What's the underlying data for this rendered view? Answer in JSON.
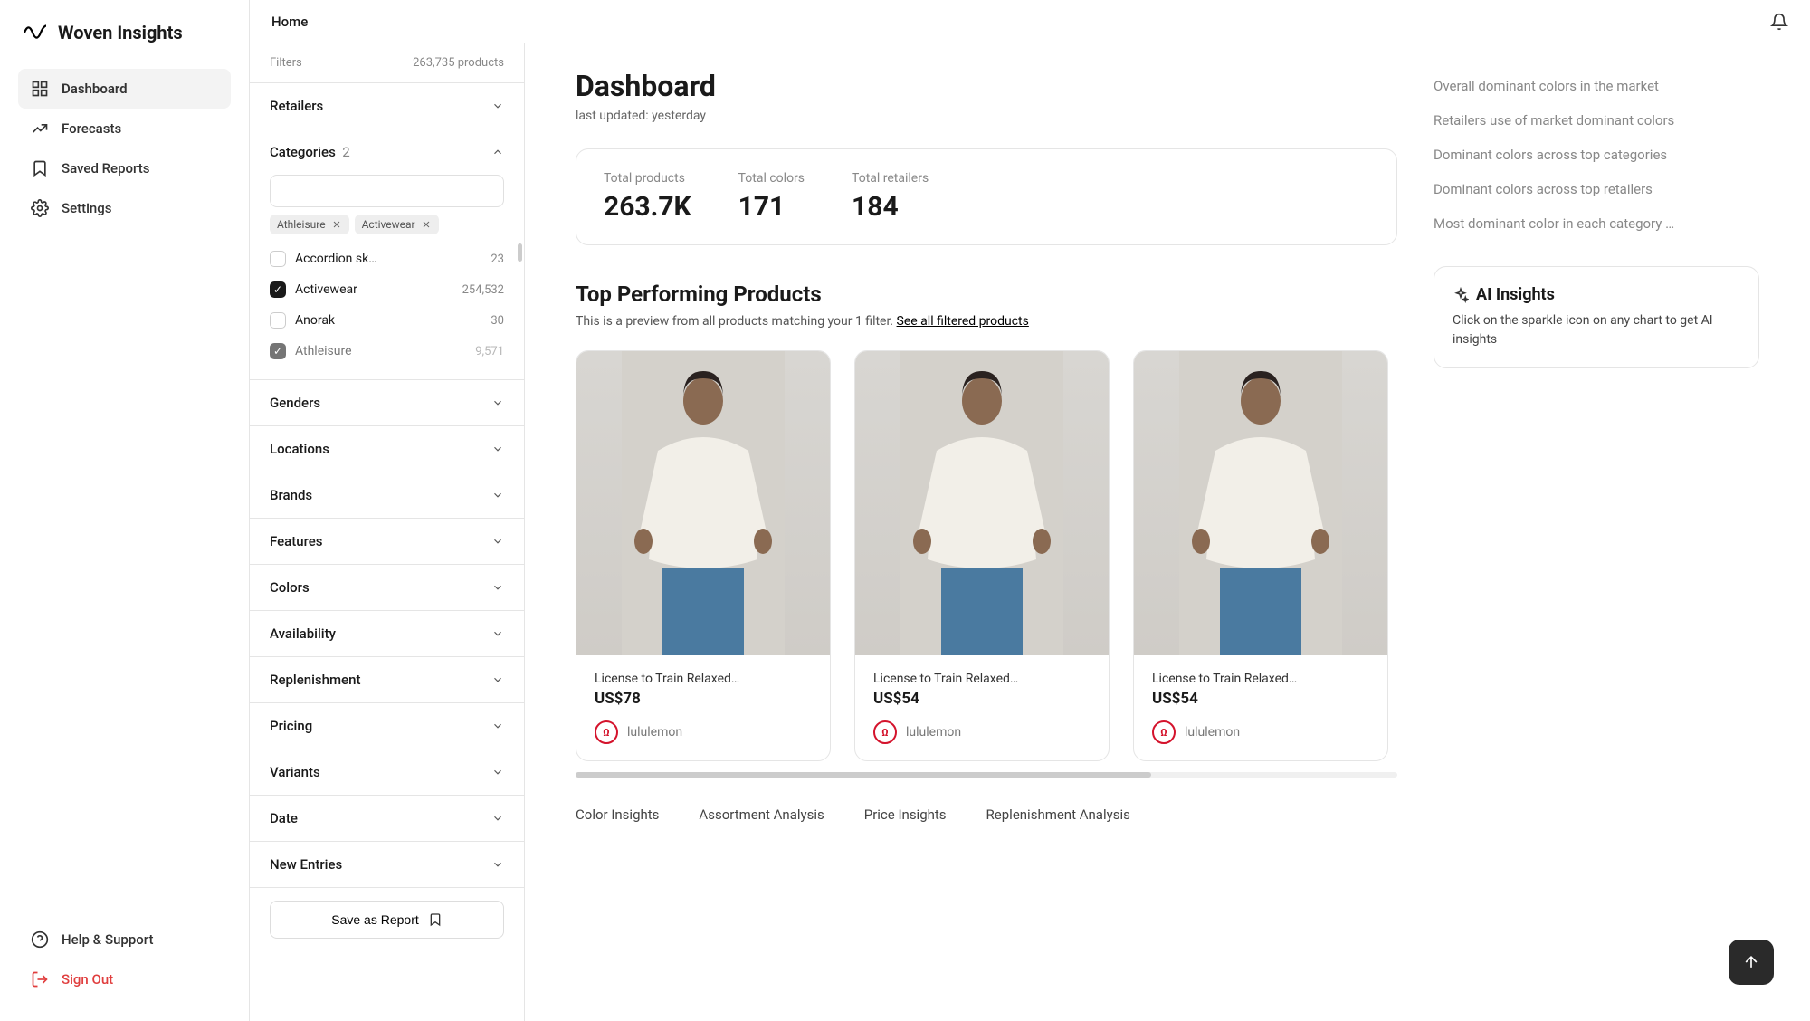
{
  "app_name": "Woven Insights",
  "breadcrumb": "Home",
  "nav": {
    "items": [
      {
        "label": "Dashboard",
        "icon": "dashboard-icon",
        "active": true
      },
      {
        "label": "Forecasts",
        "icon": "forecasts-icon"
      },
      {
        "label": "Saved Reports",
        "icon": "bookmark-icon"
      },
      {
        "label": "Settings",
        "icon": "gear-icon"
      }
    ],
    "bottom": [
      {
        "label": "Help & Support",
        "icon": "help-icon"
      },
      {
        "label": "Sign Out",
        "icon": "signout-icon",
        "danger": true
      }
    ]
  },
  "filters": {
    "header_label": "Filters",
    "product_count": "263,735 products",
    "sections": [
      {
        "label": "Retailers"
      },
      {
        "label": "Genders"
      },
      {
        "label": "Locations"
      },
      {
        "label": "Brands"
      },
      {
        "label": "Features"
      },
      {
        "label": "Colors"
      },
      {
        "label": "Availability"
      },
      {
        "label": "Replenishment"
      },
      {
        "label": "Pricing"
      },
      {
        "label": "Variants"
      },
      {
        "label": "Date"
      },
      {
        "label": "New Entries"
      }
    ],
    "categories": {
      "label": "Categories",
      "selected_count": "2",
      "chips": [
        "Athleisure",
        "Activewear"
      ],
      "items": [
        {
          "label": "Accordion sk…",
          "count": "23",
          "checked": false
        },
        {
          "label": "Activewear",
          "count": "254,532",
          "checked": true
        },
        {
          "label": "Anorak",
          "count": "30",
          "checked": false
        },
        {
          "label": "Athleisure",
          "count": "9,571",
          "checked": true
        }
      ]
    },
    "save_button": "Save as Report"
  },
  "dashboard": {
    "title": "Dashboard",
    "subtitle": "last updated: yesterday",
    "stats": [
      {
        "label": "Total products",
        "value": "263.7K"
      },
      {
        "label": "Total colors",
        "value": "171"
      },
      {
        "label": "Total retailers",
        "value": "184"
      }
    ],
    "top_products_title": "Top Performing Products",
    "top_products_lead": "This is a preview from all products matching your 1 filter. ",
    "top_products_link": "See all filtered products",
    "products": [
      {
        "name": "License to Train Relaxed…",
        "price": "US$78",
        "brand": "lululemon"
      },
      {
        "name": "License to Train Relaxed…",
        "price": "US$54",
        "brand": "lululemon"
      },
      {
        "name": "License to Train Relaxed…",
        "price": "US$54",
        "brand": "lululemon"
      }
    ],
    "tabs": [
      "Color Insights",
      "Assortment Analysis",
      "Price Insights",
      "Replenishment Analysis"
    ]
  },
  "insights": {
    "links": [
      "Overall dominant colors in the market",
      "Retailers use of market dominant colors",
      "Dominant colors across top categories",
      "Dominant colors across top retailers",
      "Most dominant color in each category …"
    ],
    "ai_title": "AI Insights",
    "ai_text": "Click on the sparkle icon on any chart to get AI insights"
  }
}
